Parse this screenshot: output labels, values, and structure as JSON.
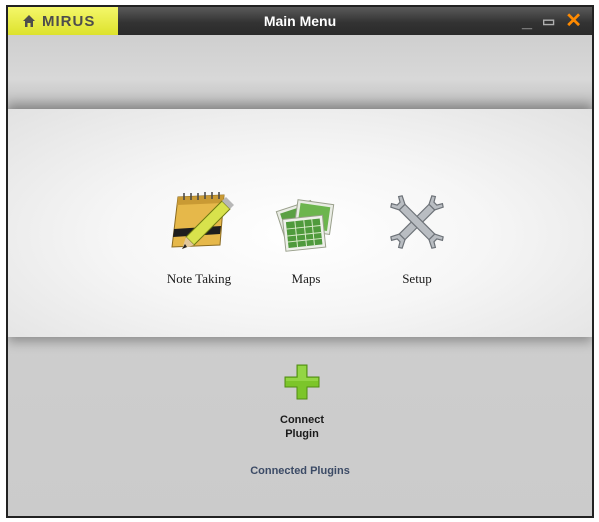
{
  "window": {
    "title": "Main Menu",
    "logo_text": "MIRUS"
  },
  "menu": {
    "items": [
      {
        "label": "Note Taking",
        "icon": "notepad-pencil-icon"
      },
      {
        "label": "Maps",
        "icon": "maps-icon"
      },
      {
        "label": "Setup",
        "icon": "wrench-tools-icon"
      }
    ]
  },
  "plugins": {
    "connect_label_line1": "Connect",
    "connect_label_line2": "Plugin",
    "connected_label": "Connected Plugins"
  },
  "colors": {
    "logo_bg": "#e8ec3c",
    "titlebar_bg": "#3a3a3a",
    "close_accent": "#ff8a00",
    "plus_green": "#7cc52a"
  }
}
